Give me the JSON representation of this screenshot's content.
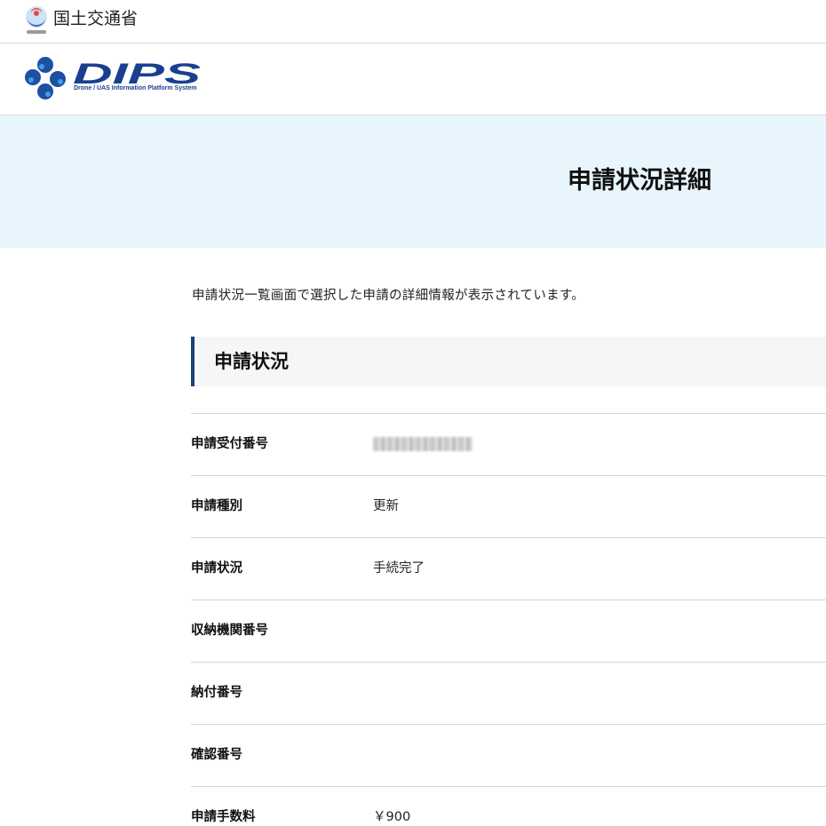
{
  "ministry": {
    "name": "国土交通省"
  },
  "brand": {
    "logo_text": "DIPS",
    "tagline": "Drone / UAS Information Platform System",
    "color": "#1a3f8f"
  },
  "page": {
    "title": "申請状況詳細",
    "intro": "申請状況一覧画面で選択した申請の詳細情報が表示されています。"
  },
  "section": {
    "heading": "申請状況"
  },
  "details": [
    {
      "label": "申請受付番号",
      "value": "",
      "redacted": true
    },
    {
      "label": "申請種別",
      "value": "更新"
    },
    {
      "label": "申請状況",
      "value": "手続完了"
    },
    {
      "label": "収納機関番号",
      "value": ""
    },
    {
      "label": "納付番号",
      "value": ""
    },
    {
      "label": "確認番号",
      "value": ""
    },
    {
      "label": "申請手数料",
      "value": "￥900"
    }
  ],
  "colors": {
    "title_band": "#e8f5fc",
    "section_accent": "#1b3f7a",
    "divider": "#d6d6d6"
  }
}
